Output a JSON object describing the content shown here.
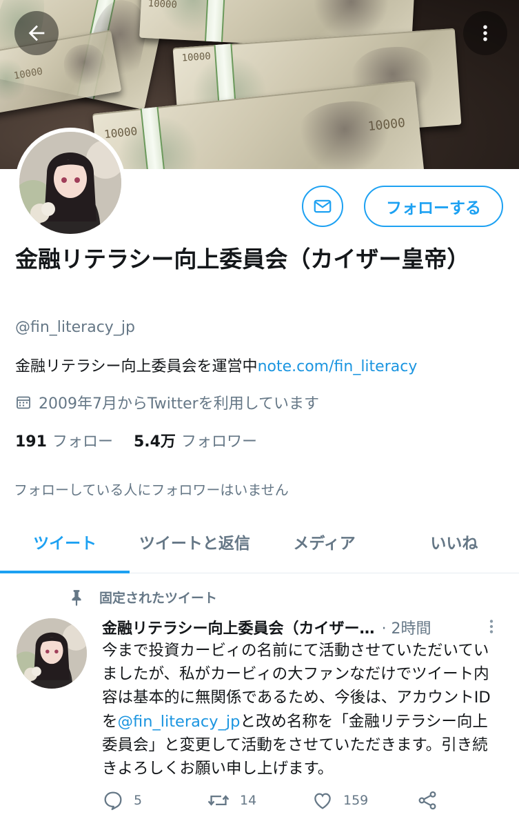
{
  "header": {
    "back_icon": "arrow-left-icon",
    "more_icon": "more-vertical-icon",
    "banner_bill_text": [
      "10000",
      "10000",
      "10000",
      "10000",
      "10000"
    ]
  },
  "profile": {
    "message_icon": "envelope-icon",
    "follow_label": "フォローする",
    "display_name": "金融リテラシー向上委員会（カイザー皇帝）",
    "handle": "@fin_literacy_jp",
    "bio_text": "金融リテラシー向上委員会を運営中",
    "bio_link": "note.com/fin_literacy",
    "joined_icon": "calendar-icon",
    "joined": "2009年7月からTwitterを利用しています",
    "following_count": "191",
    "following_label": "フォロー",
    "followers_count": "5.4万",
    "followers_label": "フォロワー",
    "followers_you_know": "フォローしている人にフォロワーはいません"
  },
  "tabs": [
    {
      "label": "ツイート",
      "active": true
    },
    {
      "label": "ツイートと返信",
      "active": false
    },
    {
      "label": "メディア",
      "active": false
    },
    {
      "label": "いいね",
      "active": false
    }
  ],
  "pinned_tweet": {
    "pinned_label": "固定されたツイート",
    "author_name": "金融リテラシー向上委員会（カイザー…",
    "time": "· 2時間",
    "text_before_mention": "今まで投資カービィの名前にて活動させていただいていましたが、私がカービィの大ファンなだけでツイート内容は基本的に無関係であるため、今後は、アカウントIDを",
    "mention": "@fin_literacy_jp",
    "text_after_mention": "と改め名称を「金融リテラシー向上委員会」と変更して活動をさせていただきます。引き続きよろしくお願い申し上げます。",
    "reply_count": "5",
    "retweet_count": "14",
    "like_count": "159"
  },
  "colors": {
    "accent": "#1da1f2",
    "link": "#1b95e0",
    "secondary_text": "#657786"
  }
}
